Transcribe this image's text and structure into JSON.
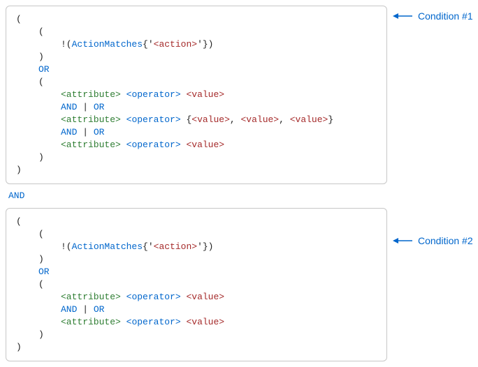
{
  "tokens": {
    "paren_open": "(",
    "paren_close": ")",
    "brace_open": "{",
    "brace_close": "}",
    "comma_sep": ", ",
    "not_paren": "!(",
    "close_paren": ")",
    "action_matches": "ActionMatches",
    "quote_open": "{'",
    "quote_close": "'}",
    "action": "<action>",
    "attribute": "<attribute>",
    "operator": "<operator>",
    "value": "<value>",
    "or_kw": "OR",
    "and_kw": "AND",
    "pipe": "|",
    "space": " "
  },
  "labels": {
    "condition1": "Condition #1",
    "condition2": "Condition #2"
  },
  "between_operator": "AND"
}
